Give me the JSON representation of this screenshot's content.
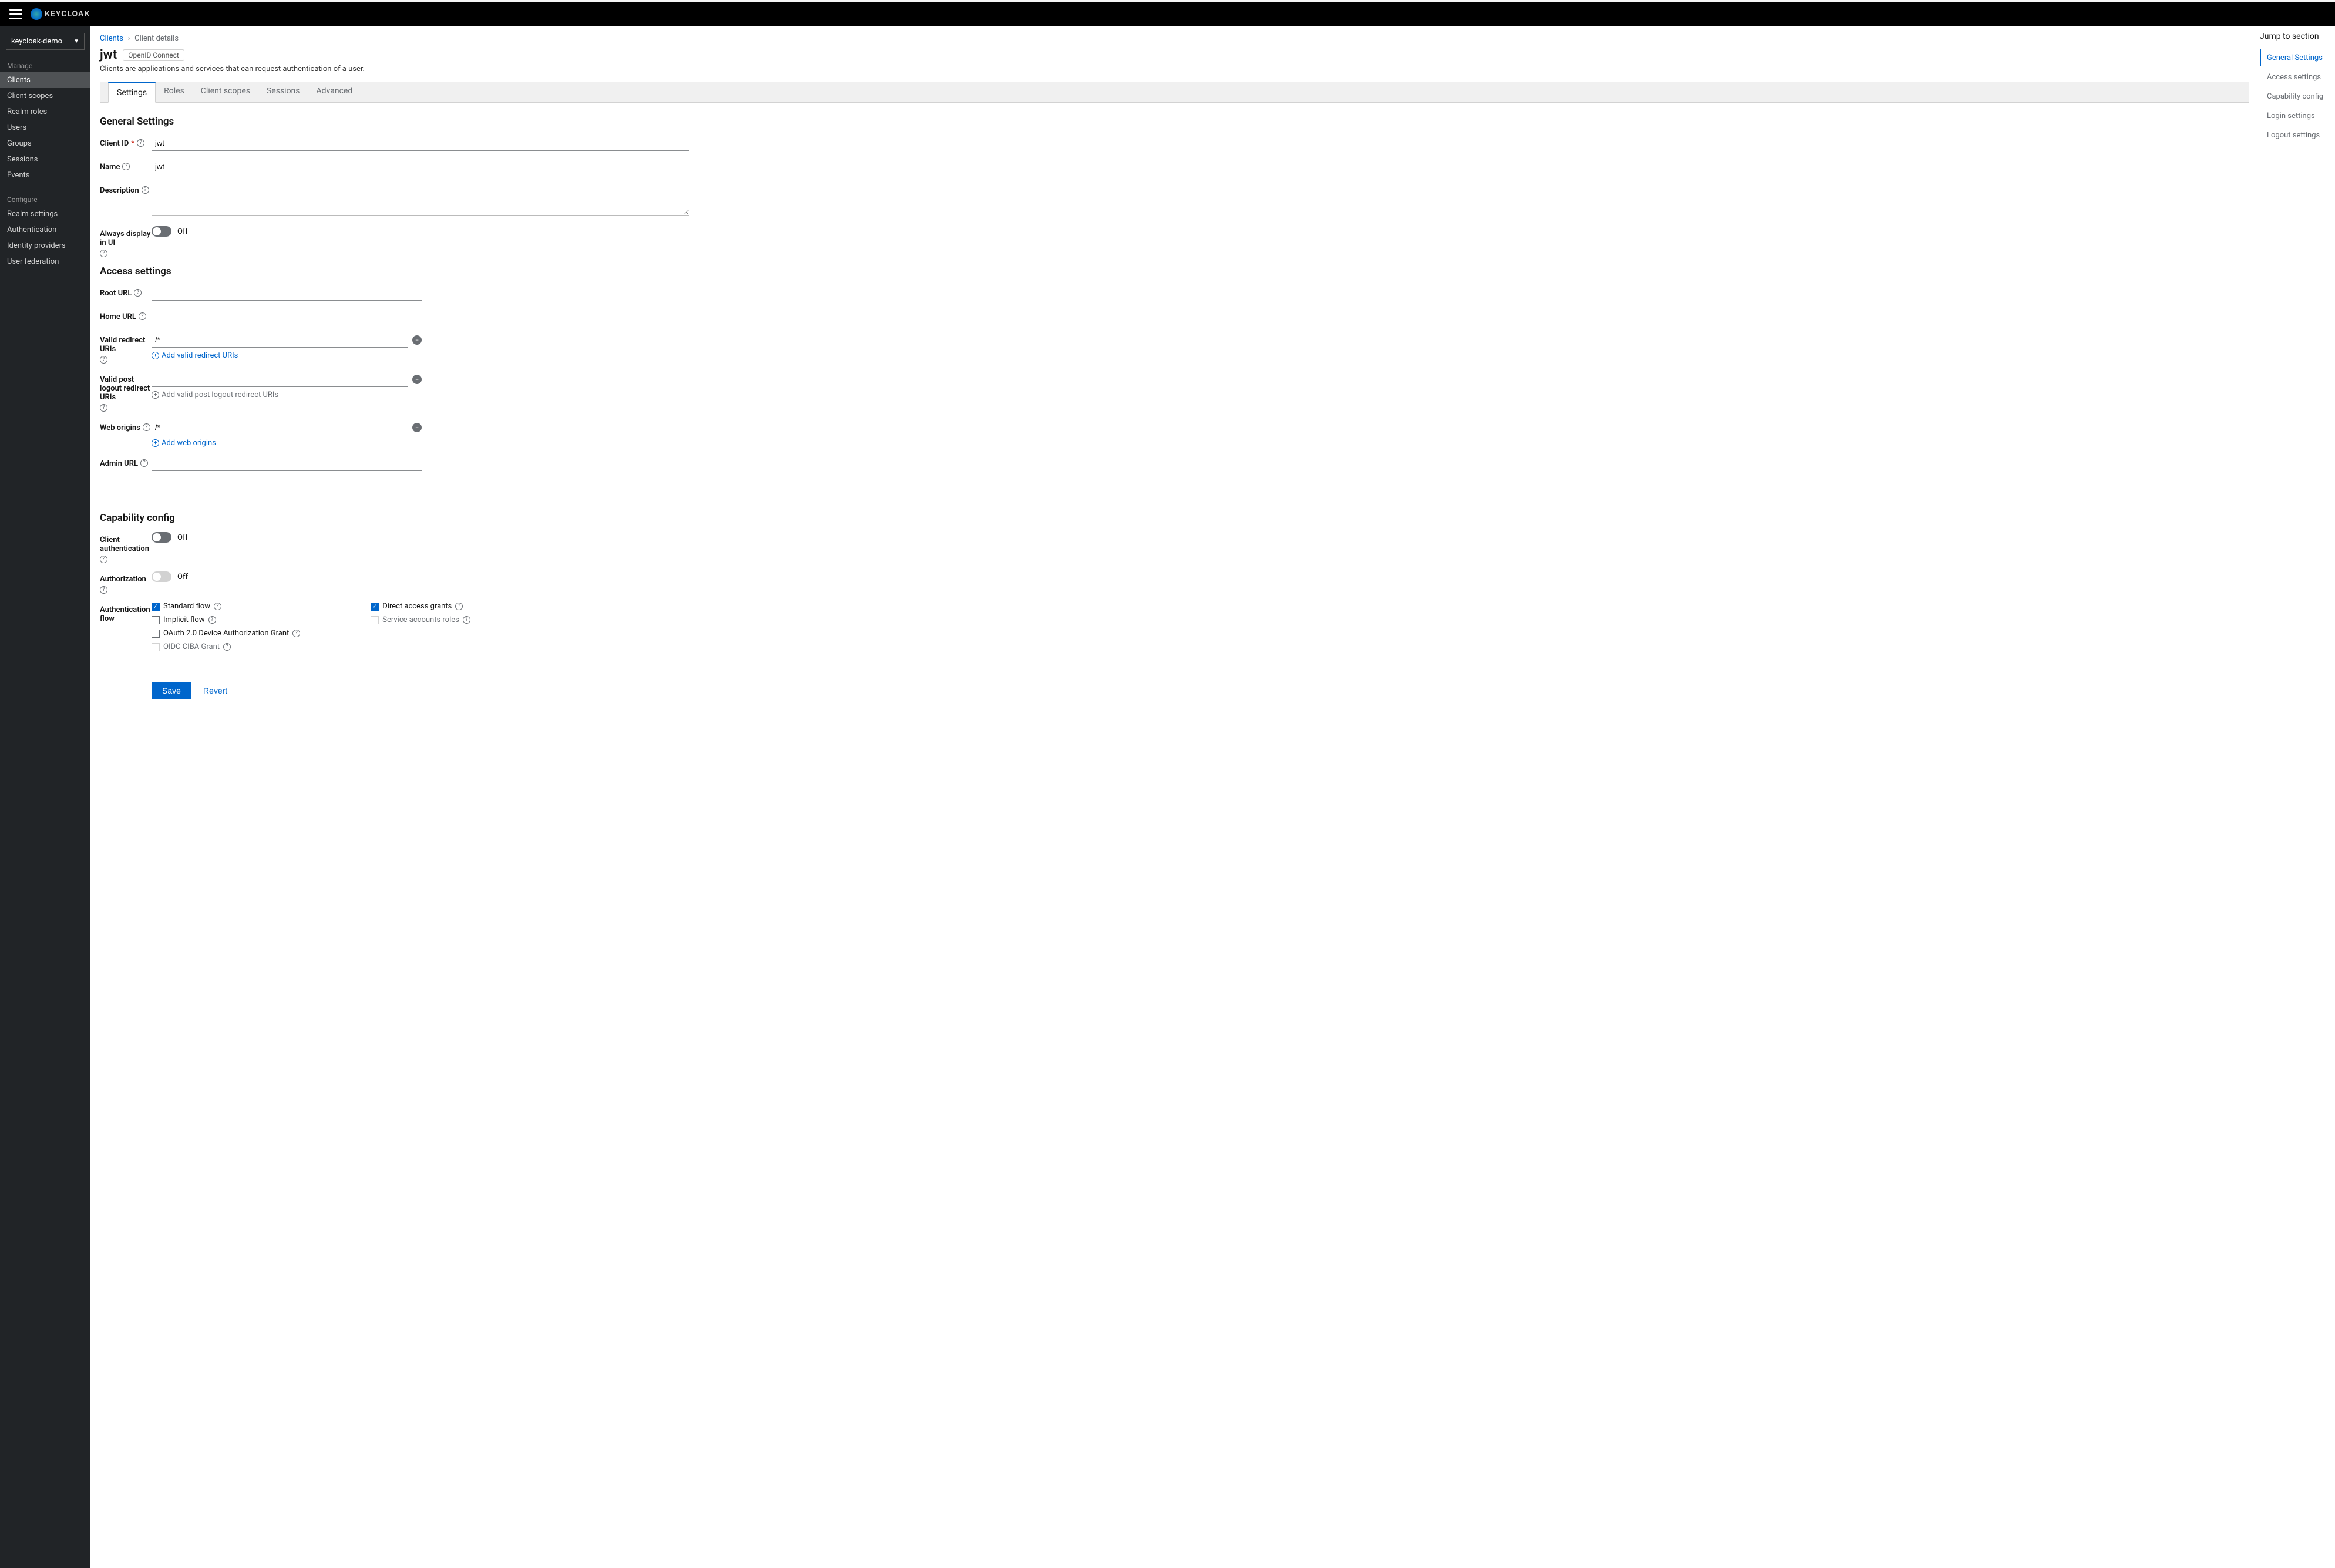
{
  "brand": "KEYCLOAK",
  "realm": "keycloak-demo",
  "sidebar": {
    "groups": [
      {
        "label": "Manage",
        "items": [
          "Clients",
          "Client scopes",
          "Realm roles",
          "Users",
          "Groups",
          "Sessions",
          "Events"
        ],
        "active": "Clients"
      },
      {
        "label": "Configure",
        "items": [
          "Realm settings",
          "Authentication",
          "Identity providers",
          "User federation"
        ]
      }
    ]
  },
  "breadcrumb": {
    "root": "Clients",
    "current": "Client details"
  },
  "page": {
    "title": "jwt",
    "protocol_badge": "OpenID Connect",
    "subtitle": "Clients are applications and services that can request authentication of a user."
  },
  "tabs": [
    "Settings",
    "Roles",
    "Client scopes",
    "Sessions",
    "Advanced"
  ],
  "active_tab": "Settings",
  "jump": {
    "title": "Jump to section",
    "items": [
      "General Settings",
      "Access settings",
      "Capability config",
      "Login settings",
      "Logout settings"
    ],
    "active": "General Settings"
  },
  "sections": {
    "general": {
      "title": "General Settings",
      "client_id": {
        "label": "Client ID",
        "required": true,
        "value": "jwt"
      },
      "name": {
        "label": "Name",
        "value": "jwt"
      },
      "description": {
        "label": "Description",
        "value": ""
      },
      "always_display": {
        "label": "Always display in UI",
        "state_label": "Off"
      }
    },
    "access": {
      "title": "Access settings",
      "root_url": {
        "label": "Root URL",
        "value": ""
      },
      "home_url": {
        "label": "Home URL",
        "value": ""
      },
      "valid_redirect": {
        "label": "Valid redirect URIs",
        "values": [
          "/*"
        ],
        "add_label": "Add valid redirect URIs"
      },
      "valid_post_logout": {
        "label": "Valid post logout redirect URIs",
        "values": [
          ""
        ],
        "add_label": "Add valid post logout redirect URIs"
      },
      "web_origins": {
        "label": "Web origins",
        "values": [
          "/*"
        ],
        "add_label": "Add web origins"
      },
      "admin_url": {
        "label": "Admin URL",
        "value": ""
      }
    },
    "capability": {
      "title": "Capability config",
      "client_auth": {
        "label": "Client authentication",
        "state_label": "Off"
      },
      "authorization": {
        "label": "Authorization",
        "state_label": "Off",
        "disabled": true
      },
      "auth_flow_label": "Authentication flow",
      "flows_left": [
        {
          "label": "Standard flow",
          "checked": true
        },
        {
          "label": "Implicit flow",
          "checked": false
        },
        {
          "label": "OAuth 2.0 Device Authorization Grant",
          "checked": false
        },
        {
          "label": "OIDC CIBA Grant",
          "checked": false,
          "disabled": true
        }
      ],
      "flows_right": [
        {
          "label": "Direct access grants",
          "checked": true
        },
        {
          "label": "Service accounts roles",
          "checked": false,
          "disabled": true
        }
      ]
    }
  },
  "buttons": {
    "save": "Save",
    "revert": "Revert"
  }
}
